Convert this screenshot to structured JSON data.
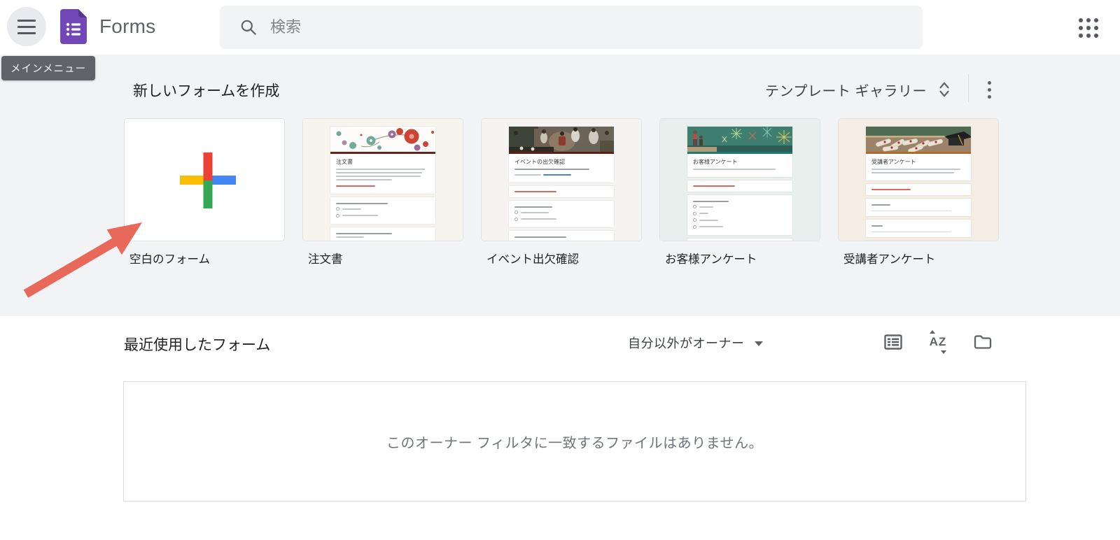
{
  "header": {
    "app_title": "Forms",
    "search_placeholder": "検索",
    "main_menu_tooltip": "メインメニュー"
  },
  "templates_section": {
    "heading": "新しいフォームを作成",
    "gallery_button_label": "テンプレート ギャラリー",
    "cards": [
      {
        "label": "空白のフォーム"
      },
      {
        "label": "注文書",
        "thumb_title": "注文書"
      },
      {
        "label": "イベント出欠確認",
        "thumb_title": "イベントの出欠確認"
      },
      {
        "label": "お客様アンケート",
        "thumb_title": "お客様アンケート"
      },
      {
        "label": "受講者アンケート",
        "thumb_title": "受講者アンケート"
      }
    ]
  },
  "recent_section": {
    "heading": "最近使用したフォーム",
    "owner_filter_selected": "自分以外がオーナー",
    "empty_message": "このオーナー フィルタに一致するファイルはありません。"
  },
  "colors": {
    "forms_purple": "#7248b9",
    "plus_red": "#ea4335",
    "plus_yellow": "#fbbc04",
    "plus_blue": "#4285f4",
    "plus_green": "#34a853",
    "annotation_arrow": "#e8685a",
    "band_background": "#f1f3f4"
  }
}
